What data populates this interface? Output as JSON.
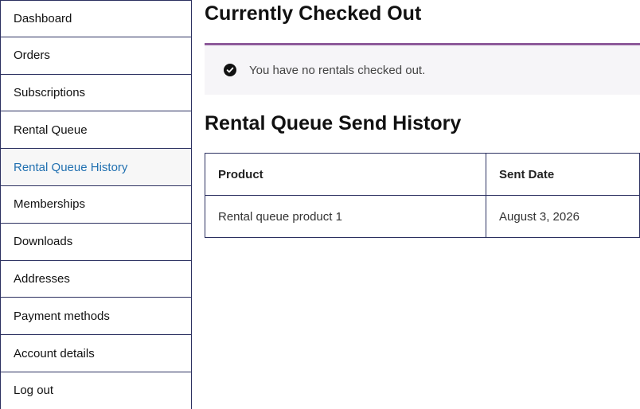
{
  "sidebar": {
    "items": [
      {
        "label": "Dashboard"
      },
      {
        "label": "Orders"
      },
      {
        "label": "Subscriptions"
      },
      {
        "label": "Rental Queue"
      },
      {
        "label": "Rental Queue History",
        "active": true
      },
      {
        "label": "Memberships"
      },
      {
        "label": "Downloads"
      },
      {
        "label": "Addresses"
      },
      {
        "label": "Payment methods"
      },
      {
        "label": "Account details"
      },
      {
        "label": "Log out"
      }
    ]
  },
  "main": {
    "checked_out": {
      "title": "Currently Checked Out",
      "notice_icon": "check-circle-icon",
      "notice_text": "You have no rentals checked out."
    },
    "history": {
      "title": "Rental Queue Send History",
      "columns": [
        "Product",
        "Sent Date"
      ],
      "rows": [
        {
          "product": "Rental queue product 1",
          "sent_date": "August 3, 2026"
        }
      ]
    }
  },
  "colors": {
    "accent_border": "#8d5a9a",
    "active_link": "#2271b1",
    "table_border": "#2b3060"
  }
}
